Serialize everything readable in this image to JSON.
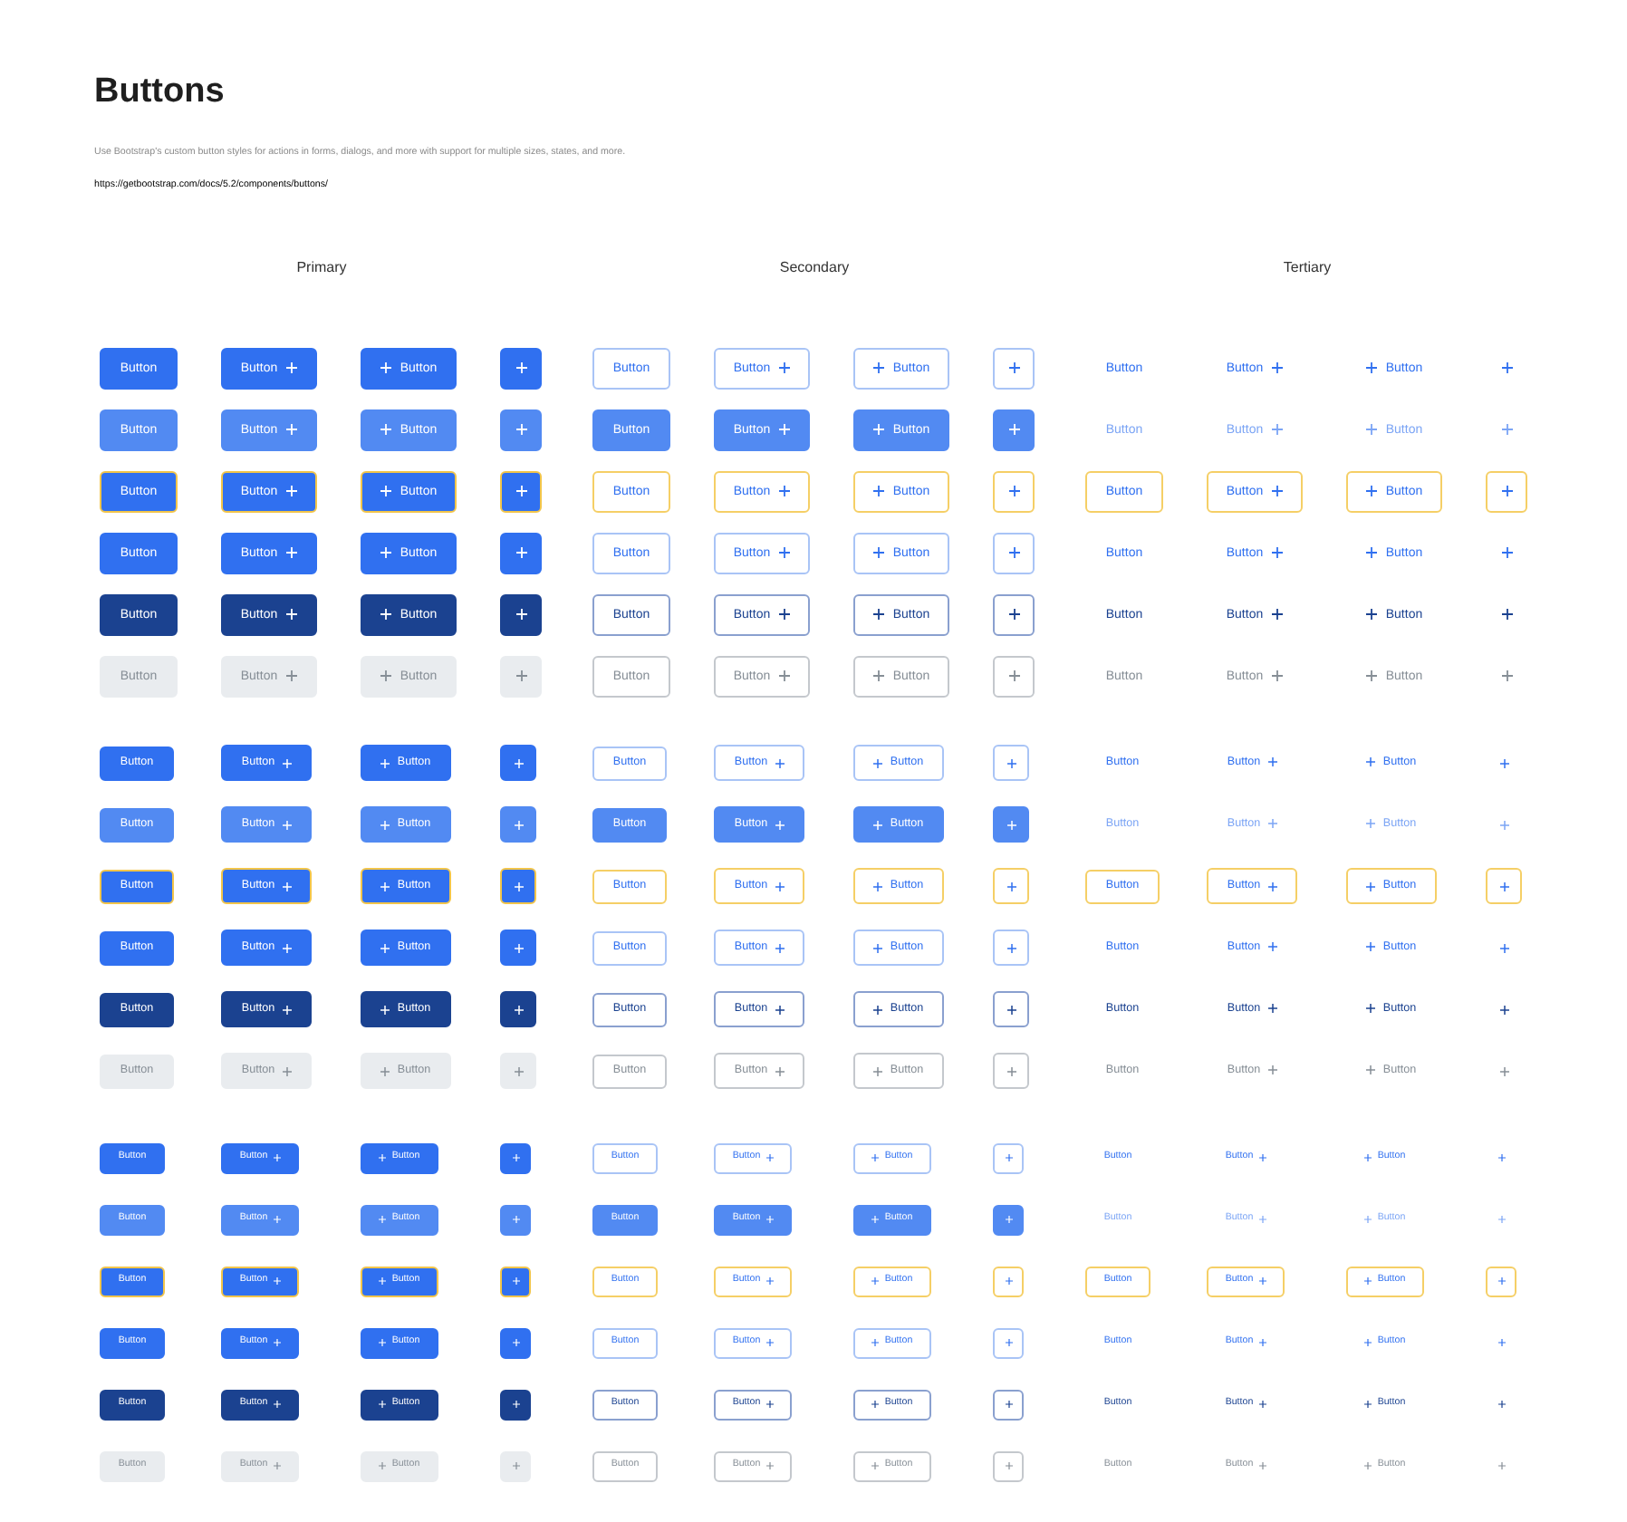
{
  "title": "Buttons",
  "description": "Use Bootstrap's custom button styles for actions in forms, dialogs, and more with support for multiple sizes, states, and more.",
  "link": "https://getbootstrap.com/docs/5.2/components/buttons/",
  "groups": [
    {
      "label": "Primary",
      "kind": "primary"
    },
    {
      "label": "Secondary",
      "kind": "secondary"
    },
    {
      "label": "Tertiary",
      "kind": "tertiary"
    }
  ],
  "sections": [
    {
      "kind": "large",
      "rows": [
        {
          "kind": "default",
          "buttons": [
            {
              "kind": "text",
              "label": "Button"
            },
            {
              "kind": "text-icon",
              "label": "Button"
            },
            {
              "kind": "icon-text",
              "label": "Button"
            },
            {
              "kind": "icon"
            },
            {
              "kind": "text",
              "label": "Button"
            },
            {
              "kind": "text-icon",
              "label": "Button"
            },
            {
              "kind": "icon-text",
              "label": "Button"
            },
            {
              "kind": "icon"
            },
            {
              "kind": "text",
              "label": "Button"
            },
            {
              "kind": "text-icon",
              "label": "Button"
            },
            {
              "kind": "icon-text",
              "label": "Button"
            },
            {
              "kind": "icon"
            }
          ]
        },
        {
          "kind": "hover",
          "buttons": [
            {
              "kind": "text",
              "label": "Button"
            },
            {
              "kind": "text-icon",
              "label": "Button"
            },
            {
              "kind": "icon-text",
              "label": "Button"
            },
            {
              "kind": "icon"
            },
            {
              "kind": "text",
              "label": "Button"
            },
            {
              "kind": "text-icon",
              "label": "Button"
            },
            {
              "kind": "icon-text",
              "label": "Button"
            },
            {
              "kind": "icon"
            },
            {
              "kind": "text",
              "label": "Button"
            },
            {
              "kind": "text-icon",
              "label": "Button"
            },
            {
              "kind": "icon-text",
              "label": "Button"
            },
            {
              "kind": "icon"
            }
          ]
        },
        {
          "kind": "focus",
          "buttons": [
            {
              "kind": "text",
              "label": "Button"
            },
            {
              "kind": "text-icon",
              "label": "Button"
            },
            {
              "kind": "icon-text",
              "label": "Button"
            },
            {
              "kind": "icon"
            },
            {
              "kind": "text",
              "label": "Button"
            },
            {
              "kind": "text-icon",
              "label": "Button"
            },
            {
              "kind": "icon-text",
              "label": "Button"
            },
            {
              "kind": "icon"
            },
            {
              "kind": "text",
              "label": "Button"
            },
            {
              "kind": "text-icon",
              "label": "Button"
            },
            {
              "kind": "icon-text",
              "label": "Button"
            },
            {
              "kind": "icon"
            }
          ]
        },
        {
          "kind": "default",
          "buttons": [
            {
              "kind": "text",
              "label": "Button"
            },
            {
              "kind": "text-icon",
              "label": "Button"
            },
            {
              "kind": "icon-text",
              "label": "Button"
            },
            {
              "kind": "icon"
            },
            {
              "kind": "text",
              "label": "Button"
            },
            {
              "kind": "text-icon",
              "label": "Button"
            },
            {
              "kind": "icon-text",
              "label": "Button"
            },
            {
              "kind": "icon"
            },
            {
              "kind": "text",
              "label": "Button"
            },
            {
              "kind": "text-icon",
              "label": "Button"
            },
            {
              "kind": "icon-text",
              "label": "Button"
            },
            {
              "kind": "icon"
            }
          ]
        },
        {
          "kind": "pressed",
          "buttons": [
            {
              "kind": "text",
              "label": "Button"
            },
            {
              "kind": "text-icon",
              "label": "Button"
            },
            {
              "kind": "icon-text",
              "label": "Button"
            },
            {
              "kind": "icon"
            },
            {
              "kind": "text",
              "label": "Button"
            },
            {
              "kind": "text-icon",
              "label": "Button"
            },
            {
              "kind": "icon-text",
              "label": "Button"
            },
            {
              "kind": "icon"
            },
            {
              "kind": "text",
              "label": "Button"
            },
            {
              "kind": "text-icon",
              "label": "Button"
            },
            {
              "kind": "icon-text",
              "label": "Button"
            },
            {
              "kind": "icon"
            }
          ]
        },
        {
          "kind": "disabled",
          "buttons": [
            {
              "kind": "text",
              "label": "Button"
            },
            {
              "kind": "text-icon",
              "label": "Button"
            },
            {
              "kind": "icon-text",
              "label": "Button"
            },
            {
              "kind": "icon"
            },
            {
              "kind": "text",
              "label": "Button"
            },
            {
              "kind": "text-icon",
              "label": "Button"
            },
            {
              "kind": "icon-text",
              "label": "Button"
            },
            {
              "kind": "icon"
            },
            {
              "kind": "text",
              "label": "Button"
            },
            {
              "kind": "text-icon",
              "label": "Button"
            },
            {
              "kind": "icon-text",
              "label": "Button"
            },
            {
              "kind": "icon"
            }
          ]
        }
      ]
    },
    {
      "kind": "medium",
      "rows": [
        {
          "kind": "default",
          "buttons": [
            {
              "kind": "text",
              "label": "Button"
            },
            {
              "kind": "text-icon",
              "label": "Button"
            },
            {
              "kind": "icon-text",
              "label": "Button"
            },
            {
              "kind": "icon"
            },
            {
              "kind": "text",
              "label": "Button"
            },
            {
              "kind": "text-icon",
              "label": "Button"
            },
            {
              "kind": "icon-text",
              "label": "Button"
            },
            {
              "kind": "icon"
            },
            {
              "kind": "text",
              "label": "Button"
            },
            {
              "kind": "text-icon",
              "label": "Button"
            },
            {
              "kind": "icon-text",
              "label": "Button"
            },
            {
              "kind": "icon"
            }
          ]
        },
        {
          "kind": "hover",
          "buttons": [
            {
              "kind": "text",
              "label": "Button"
            },
            {
              "kind": "text-icon",
              "label": "Button"
            },
            {
              "kind": "icon-text",
              "label": "Button"
            },
            {
              "kind": "icon"
            },
            {
              "kind": "text",
              "label": "Button"
            },
            {
              "kind": "text-icon",
              "label": "Button"
            },
            {
              "kind": "icon-text",
              "label": "Button"
            },
            {
              "kind": "icon"
            },
            {
              "kind": "text",
              "label": "Button"
            },
            {
              "kind": "text-icon",
              "label": "Button"
            },
            {
              "kind": "icon-text",
              "label": "Button"
            },
            {
              "kind": "icon"
            }
          ]
        },
        {
          "kind": "focus",
          "buttons": [
            {
              "kind": "text",
              "label": "Button"
            },
            {
              "kind": "text-icon",
              "label": "Button"
            },
            {
              "kind": "icon-text",
              "label": "Button"
            },
            {
              "kind": "icon"
            },
            {
              "kind": "text",
              "label": "Button"
            },
            {
              "kind": "text-icon",
              "label": "Button"
            },
            {
              "kind": "icon-text",
              "label": "Button"
            },
            {
              "kind": "icon"
            },
            {
              "kind": "text",
              "label": "Button"
            },
            {
              "kind": "text-icon",
              "label": "Button"
            },
            {
              "kind": "icon-text",
              "label": "Button"
            },
            {
              "kind": "icon"
            }
          ]
        },
        {
          "kind": "default",
          "buttons": [
            {
              "kind": "text",
              "label": "Button"
            },
            {
              "kind": "text-icon",
              "label": "Button"
            },
            {
              "kind": "icon-text",
              "label": "Button"
            },
            {
              "kind": "icon"
            },
            {
              "kind": "text",
              "label": "Button"
            },
            {
              "kind": "text-icon",
              "label": "Button"
            },
            {
              "kind": "icon-text",
              "label": "Button"
            },
            {
              "kind": "icon"
            },
            {
              "kind": "text",
              "label": "Button"
            },
            {
              "kind": "text-icon",
              "label": "Button"
            },
            {
              "kind": "icon-text",
              "label": "Button"
            },
            {
              "kind": "icon"
            }
          ]
        },
        {
          "kind": "pressed",
          "buttons": [
            {
              "kind": "text",
              "label": "Button"
            },
            {
              "kind": "text-icon",
              "label": "Button"
            },
            {
              "kind": "icon-text",
              "label": "Button"
            },
            {
              "kind": "icon"
            },
            {
              "kind": "text",
              "label": "Button"
            },
            {
              "kind": "text-icon",
              "label": "Button"
            },
            {
              "kind": "icon-text",
              "label": "Button"
            },
            {
              "kind": "icon"
            },
            {
              "kind": "text",
              "label": "Button"
            },
            {
              "kind": "text-icon",
              "label": "Button"
            },
            {
              "kind": "icon-text",
              "label": "Button"
            },
            {
              "kind": "icon"
            }
          ]
        },
        {
          "kind": "disabled",
          "buttons": [
            {
              "kind": "text",
              "label": "Button"
            },
            {
              "kind": "text-icon",
              "label": "Button"
            },
            {
              "kind": "icon-text",
              "label": "Button"
            },
            {
              "kind": "icon"
            },
            {
              "kind": "text",
              "label": "Button"
            },
            {
              "kind": "text-icon",
              "label": "Button"
            },
            {
              "kind": "icon-text",
              "label": "Button"
            },
            {
              "kind": "icon"
            },
            {
              "kind": "text",
              "label": "Button"
            },
            {
              "kind": "text-icon",
              "label": "Button"
            },
            {
              "kind": "icon-text",
              "label": "Button"
            },
            {
              "kind": "icon"
            }
          ]
        }
      ]
    },
    {
      "kind": "small",
      "rows": [
        {
          "kind": "default",
          "buttons": [
            {
              "kind": "text",
              "label": "Button"
            },
            {
              "kind": "text-icon",
              "label": "Button"
            },
            {
              "kind": "icon-text",
              "label": "Button"
            },
            {
              "kind": "icon"
            },
            {
              "kind": "text",
              "label": "Button"
            },
            {
              "kind": "text-icon",
              "label": "Button"
            },
            {
              "kind": "icon-text",
              "label": "Button"
            },
            {
              "kind": "icon"
            },
            {
              "kind": "text",
              "label": "Button"
            },
            {
              "kind": "text-icon",
              "label": "Button"
            },
            {
              "kind": "icon-text",
              "label": "Button"
            },
            {
              "kind": "icon"
            }
          ]
        },
        {
          "kind": "hover",
          "buttons": [
            {
              "kind": "text",
              "label": "Button"
            },
            {
              "kind": "text-icon",
              "label": "Button"
            },
            {
              "kind": "icon-text",
              "label": "Button"
            },
            {
              "kind": "icon"
            },
            {
              "kind": "text",
              "label": "Button"
            },
            {
              "kind": "text-icon",
              "label": "Button"
            },
            {
              "kind": "icon-text",
              "label": "Button"
            },
            {
              "kind": "icon"
            },
            {
              "kind": "text",
              "label": "Button"
            },
            {
              "kind": "text-icon",
              "label": "Button"
            },
            {
              "kind": "icon-text",
              "label": "Button"
            },
            {
              "kind": "icon"
            }
          ]
        },
        {
          "kind": "focus",
          "buttons": [
            {
              "kind": "text",
              "label": "Button"
            },
            {
              "kind": "text-icon",
              "label": "Button"
            },
            {
              "kind": "icon-text",
              "label": "Button"
            },
            {
              "kind": "icon"
            },
            {
              "kind": "text",
              "label": "Button"
            },
            {
              "kind": "text-icon",
              "label": "Button"
            },
            {
              "kind": "icon-text",
              "label": "Button"
            },
            {
              "kind": "icon"
            },
            {
              "kind": "text",
              "label": "Button"
            },
            {
              "kind": "text-icon",
              "label": "Button"
            },
            {
              "kind": "icon-text",
              "label": "Button"
            },
            {
              "kind": "icon"
            }
          ]
        },
        {
          "kind": "default",
          "buttons": [
            {
              "kind": "text",
              "label": "Button"
            },
            {
              "kind": "text-icon",
              "label": "Button"
            },
            {
              "kind": "icon-text",
              "label": "Button"
            },
            {
              "kind": "icon"
            },
            {
              "kind": "text",
              "label": "Button"
            },
            {
              "kind": "text-icon",
              "label": "Button"
            },
            {
              "kind": "icon-text",
              "label": "Button"
            },
            {
              "kind": "icon"
            },
            {
              "kind": "text",
              "label": "Button"
            },
            {
              "kind": "text-icon",
              "label": "Button"
            },
            {
              "kind": "icon-text",
              "label": "Button"
            },
            {
              "kind": "icon"
            }
          ]
        },
        {
          "kind": "pressed",
          "buttons": [
            {
              "kind": "text",
              "label": "Button"
            },
            {
              "kind": "text-icon",
              "label": "Button"
            },
            {
              "kind": "icon-text",
              "label": "Button"
            },
            {
              "kind": "icon"
            },
            {
              "kind": "text",
              "label": "Button"
            },
            {
              "kind": "text-icon",
              "label": "Button"
            },
            {
              "kind": "icon-text",
              "label": "Button"
            },
            {
              "kind": "icon"
            },
            {
              "kind": "text",
              "label": "Button"
            },
            {
              "kind": "text-icon",
              "label": "Button"
            },
            {
              "kind": "icon-text",
              "label": "Button"
            },
            {
              "kind": "icon"
            }
          ]
        },
        {
          "kind": "disabled",
          "buttons": [
            {
              "kind": "text",
              "label": "Button"
            },
            {
              "kind": "text-icon",
              "label": "Button"
            },
            {
              "kind": "icon-text",
              "label": "Button"
            },
            {
              "kind": "icon"
            },
            {
              "kind": "text",
              "label": "Button"
            },
            {
              "kind": "text-icon",
              "label": "Button"
            },
            {
              "kind": "icon-text",
              "label": "Button"
            },
            {
              "kind": "icon"
            },
            {
              "kind": "text",
              "label": "Button"
            },
            {
              "kind": "text-icon",
              "label": "Button"
            },
            {
              "kind": "icon-text",
              "label": "Button"
            },
            {
              "kind": "icon"
            }
          ]
        }
      ]
    }
  ]
}
